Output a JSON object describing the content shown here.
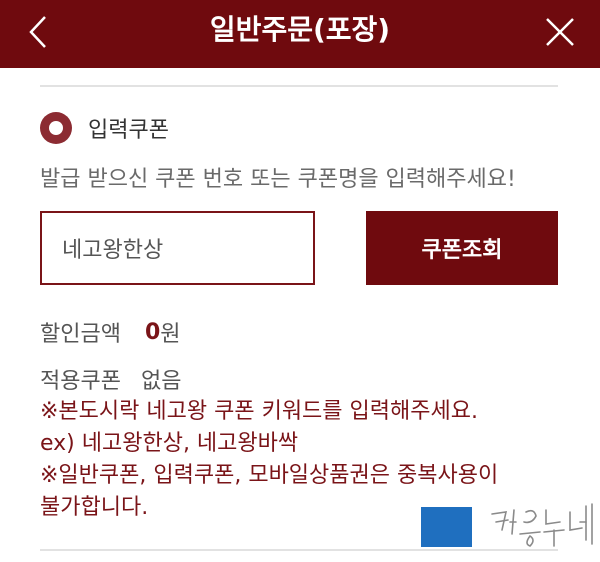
{
  "header": {
    "title": "일반주문(포장)",
    "back_icon": "chevron-left-icon",
    "close_icon": "close-icon",
    "background": "#6f0a0e"
  },
  "coupon": {
    "radio_label": "입력쿠폰",
    "radio_selected": true,
    "guide": "발급 받으신 쿠폰 번호 또는 쿠폰명을 입력해주세요!",
    "input_value": "네고왕한상",
    "lookup_label": "쿠폰조회"
  },
  "discount": {
    "label": "할인금액",
    "amount": "0",
    "unit": "원"
  },
  "applied": {
    "label": "적용쿠폰",
    "value": "없음"
  },
  "notes": [
    "※본도시락 네고왕 쿠폰 키워드를 입력해주세요.",
    "ex) 네고왕한상, 네고왕바싹",
    "※일반쿠폰, 입력쿠폰, 모바일상품권은 중복사용이",
    "불가합니다."
  ],
  "watermark": "검은누대",
  "colors": {
    "accent": "#6f0a0e",
    "accent_text": "#7a1418",
    "radio": "#8c2b32",
    "blue_box": "#1f6fbf"
  }
}
